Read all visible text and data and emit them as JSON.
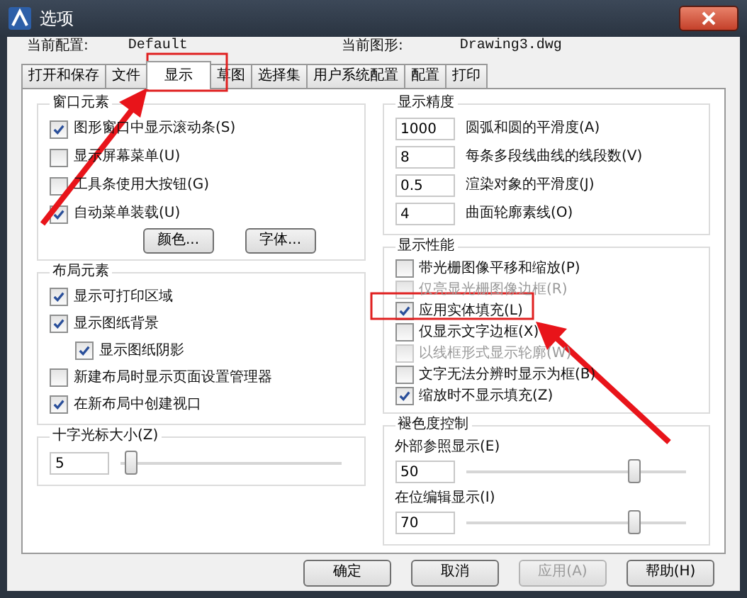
{
  "window": {
    "title": "选项"
  },
  "profile": {
    "label": "当前配置:",
    "value": "Default"
  },
  "drawing": {
    "label": "当前图形:",
    "value": "Drawing3.dwg"
  },
  "tabs": [
    {
      "label": "打开和保存",
      "selected": false
    },
    {
      "label": "文件",
      "selected": false
    },
    {
      "label": "显示",
      "selected": true
    },
    {
      "label": "草图",
      "selected": false
    },
    {
      "label": "选择集",
      "selected": false
    },
    {
      "label": "用户系统配置",
      "selected": false
    },
    {
      "label": "配置",
      "selected": false
    },
    {
      "label": "打印",
      "selected": false
    }
  ],
  "window_elements": {
    "title": "窗口元素",
    "checkboxes": [
      {
        "label": "图形窗口中显示滚动条(S)",
        "checked": true
      },
      {
        "label": "显示屏幕菜单(U)",
        "checked": false
      },
      {
        "label": "工具条使用大按钮(G)",
        "checked": false
      },
      {
        "label": "自动菜单装载(U)",
        "checked": true
      }
    ],
    "buttons": [
      "颜色...",
      "字体..."
    ]
  },
  "layout_elements": {
    "title": "布局元素",
    "checkboxes": [
      {
        "label": "显示可打印区域",
        "checked": true
      },
      {
        "label": "显示图纸背景",
        "checked": true,
        "children": [
          {
            "label": "显示图纸阴影",
            "checked": true
          }
        ]
      },
      {
        "label": "新建布局时显示页面设置管理器",
        "checked": false
      },
      {
        "label": "在新布局中创建视口",
        "checked": true
      }
    ]
  },
  "crosshair": {
    "title": "十字光标大小(Z)",
    "value": "5",
    "level": 0.05
  },
  "display_resolution": {
    "title": "显示精度",
    "fields": [
      {
        "value": "1000",
        "label": "圆弧和圆的平滑度(A)"
      },
      {
        "value": "8",
        "label": "每条多段线曲线的线段数(V)"
      },
      {
        "value": "0.5",
        "label": "渲染对象的平滑度(J)"
      },
      {
        "value": "4",
        "label": "曲面轮廓素线(O)"
      }
    ]
  },
  "display_performance": {
    "title": "显示性能",
    "checkboxes": [
      {
        "label": "带光栅图像平移和缩放(P)",
        "checked": false,
        "disabled": false
      },
      {
        "label": "仅亮显光栅图像边框(R)",
        "checked": false,
        "disabled": true
      },
      {
        "label": "应用实体填充(L)",
        "checked": true,
        "disabled": false
      },
      {
        "label": "仅显示文字边框(X)",
        "checked": false,
        "disabled": false
      },
      {
        "label": "以线框形式显示轮廓(W)",
        "checked": false,
        "disabled": true
      },
      {
        "label": "文字无法分辨时显示为框(B)",
        "checked": false,
        "disabled": false
      },
      {
        "label": "缩放时不显示填充(Z)",
        "checked": true,
        "disabled": false
      }
    ]
  },
  "fade_control": {
    "title": "褪色度控制",
    "sliders": [
      {
        "label": "外部参照显示(E)",
        "value": "50",
        "level": 0.77
      },
      {
        "label": "在位编辑显示(I)",
        "value": "70",
        "level": 0.77
      }
    ]
  },
  "buttons": [
    {
      "label": "确定",
      "disabled": false
    },
    {
      "label": "取消",
      "disabled": false
    },
    {
      "label": "应用(A)",
      "disabled": true
    },
    {
      "label": "帮助(H)",
      "disabled": false
    }
  ]
}
